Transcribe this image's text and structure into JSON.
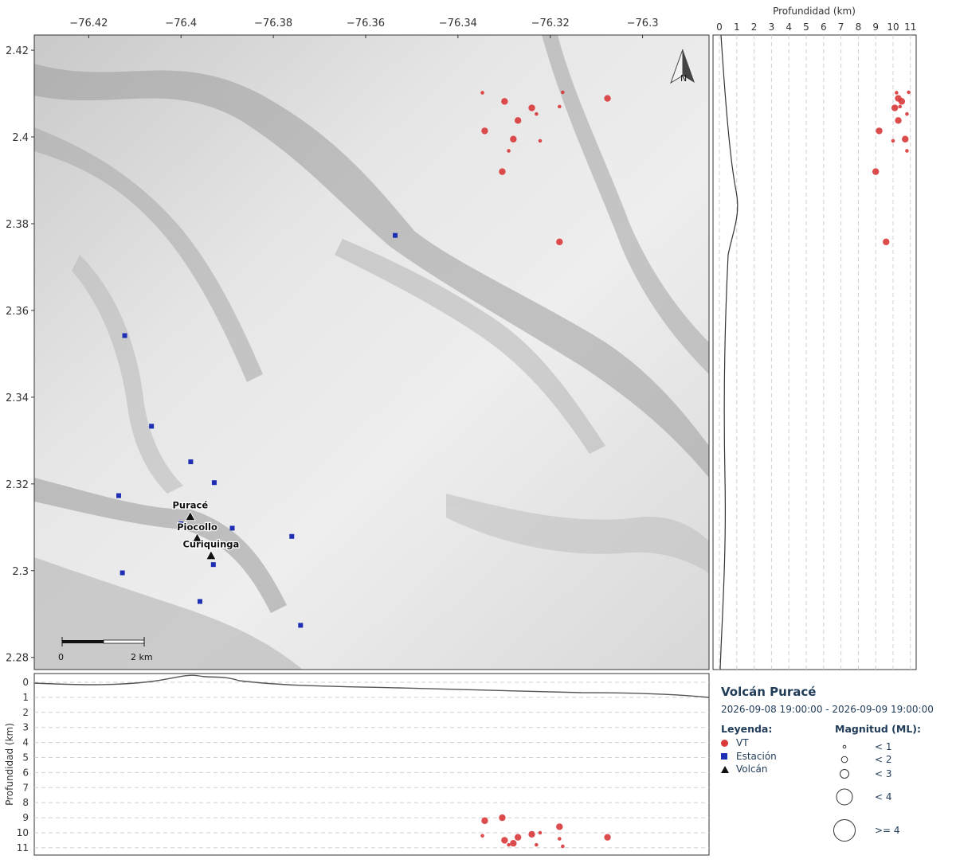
{
  "map": {
    "top_axis_ticks": [
      "−76.42",
      "−76.4",
      "−76.38",
      "−76.36",
      "−76.34",
      "−76.32",
      "−76.3"
    ],
    "left_axis_ticks": [
      "2.42",
      "2.4",
      "2.38",
      "2.36",
      "2.34",
      "2.32",
      "2.3",
      "2.28"
    ],
    "north_label": "N",
    "scale_bar": {
      "start_label": "0",
      "end_label": "2  km"
    },
    "volcanoes": [
      {
        "name": "Puracé",
        "lon": -76.398,
        "lat": 2.3125
      },
      {
        "name": "Piocollo",
        "lon": -76.3965,
        "lat": 2.3075
      },
      {
        "name": "Curiquinga",
        "lon": -76.3935,
        "lat": 2.3035
      }
    ],
    "stations": [
      {
        "lon": -76.3536,
        "lat": 2.3773
      },
      {
        "lon": -76.4122,
        "lat": 2.3542
      },
      {
        "lon": -76.4064,
        "lat": 2.3333
      },
      {
        "lon": -76.3979,
        "lat": 2.3251
      },
      {
        "lon": -76.3928,
        "lat": 2.3203
      },
      {
        "lon": -76.4135,
        "lat": 2.3173
      },
      {
        "lon": -76.4,
        "lat": 2.3108
      },
      {
        "lon": -76.3889,
        "lat": 2.3098
      },
      {
        "lon": -76.376,
        "lat": 2.3079
      },
      {
        "lon": -76.393,
        "lat": 2.3014
      },
      {
        "lon": -76.4127,
        "lat": 2.2995
      },
      {
        "lon": -76.3959,
        "lat": 2.2929
      },
      {
        "lon": -76.3741,
        "lat": 2.2874
      }
    ]
  },
  "chart_data": {
    "type": "scatter",
    "title": "Volcán Puracé",
    "date_range": "2026-09-08 19:00:00 - 2026-09-09 19:00:00",
    "x_axis": "longitude",
    "y_axis": "latitude",
    "xlim": [
      -76.4318,
      -76.2856
    ],
    "ylim": [
      2.2772,
      2.4235
    ],
    "depth_axis_label": "Profundidad (km)",
    "depth_ticks": [
      "0",
      "1",
      "2",
      "3",
      "4",
      "5",
      "6",
      "7",
      "8",
      "9",
      "10",
      "11"
    ],
    "depth_range": [
      0,
      11
    ],
    "series": [
      {
        "name": "VT",
        "color": "#d9393a",
        "points": [
          {
            "lon": -76.3347,
            "lat": 2.4102,
            "depth": 10.2,
            "mag": 0.5
          },
          {
            "lon": -76.3299,
            "lat": 2.4082,
            "depth": 10.5,
            "mag": 1.5
          },
          {
            "lon": -76.324,
            "lat": 2.4067,
            "depth": 10.1,
            "mag": 1.5
          },
          {
            "lon": -76.323,
            "lat": 2.4053,
            "depth": 10.8,
            "mag": 0.8
          },
          {
            "lon": -76.318,
            "lat": 2.407,
            "depth": 10.4,
            "mag": 0.5
          },
          {
            "lon": -76.3173,
            "lat": 2.4103,
            "depth": 10.9,
            "mag": 0.5
          },
          {
            "lon": -76.327,
            "lat": 2.4038,
            "depth": 10.3,
            "mag": 1.5
          },
          {
            "lon": -76.3076,
            "lat": 2.4089,
            "depth": 10.3,
            "mag": 1.5
          },
          {
            "lon": -76.3342,
            "lat": 2.4014,
            "depth": 9.2,
            "mag": 1.5
          },
          {
            "lon": -76.328,
            "lat": 2.3995,
            "depth": 10.7,
            "mag": 1.5
          },
          {
            "lon": -76.3222,
            "lat": 2.3991,
            "depth": 10.0,
            "mag": 0.5
          },
          {
            "lon": -76.329,
            "lat": 2.3968,
            "depth": 10.8,
            "mag": 0.5
          },
          {
            "lon": -76.3304,
            "lat": 2.392,
            "depth": 9.0,
            "mag": 1.5
          },
          {
            "lon": -76.318,
            "lat": 2.3758,
            "depth": 9.6,
            "mag": 1.5
          }
        ]
      },
      {
        "name": "Estación",
        "color": "#1f2fb3"
      },
      {
        "name": "Volcán",
        "color": "#111111"
      }
    ]
  },
  "legend": {
    "heading": "Leyenda:",
    "items": [
      {
        "label": "VT",
        "color": "#d9393a"
      },
      {
        "label": "Estación",
        "color": "#1f2fb3"
      },
      {
        "label": "Volcán",
        "color": "#111111"
      }
    ],
    "magnitude_heading": "Magnitud (ML):",
    "magnitudes": [
      "< 1",
      "< 2",
      "< 3",
      "< 4",
      ">= 4"
    ]
  }
}
